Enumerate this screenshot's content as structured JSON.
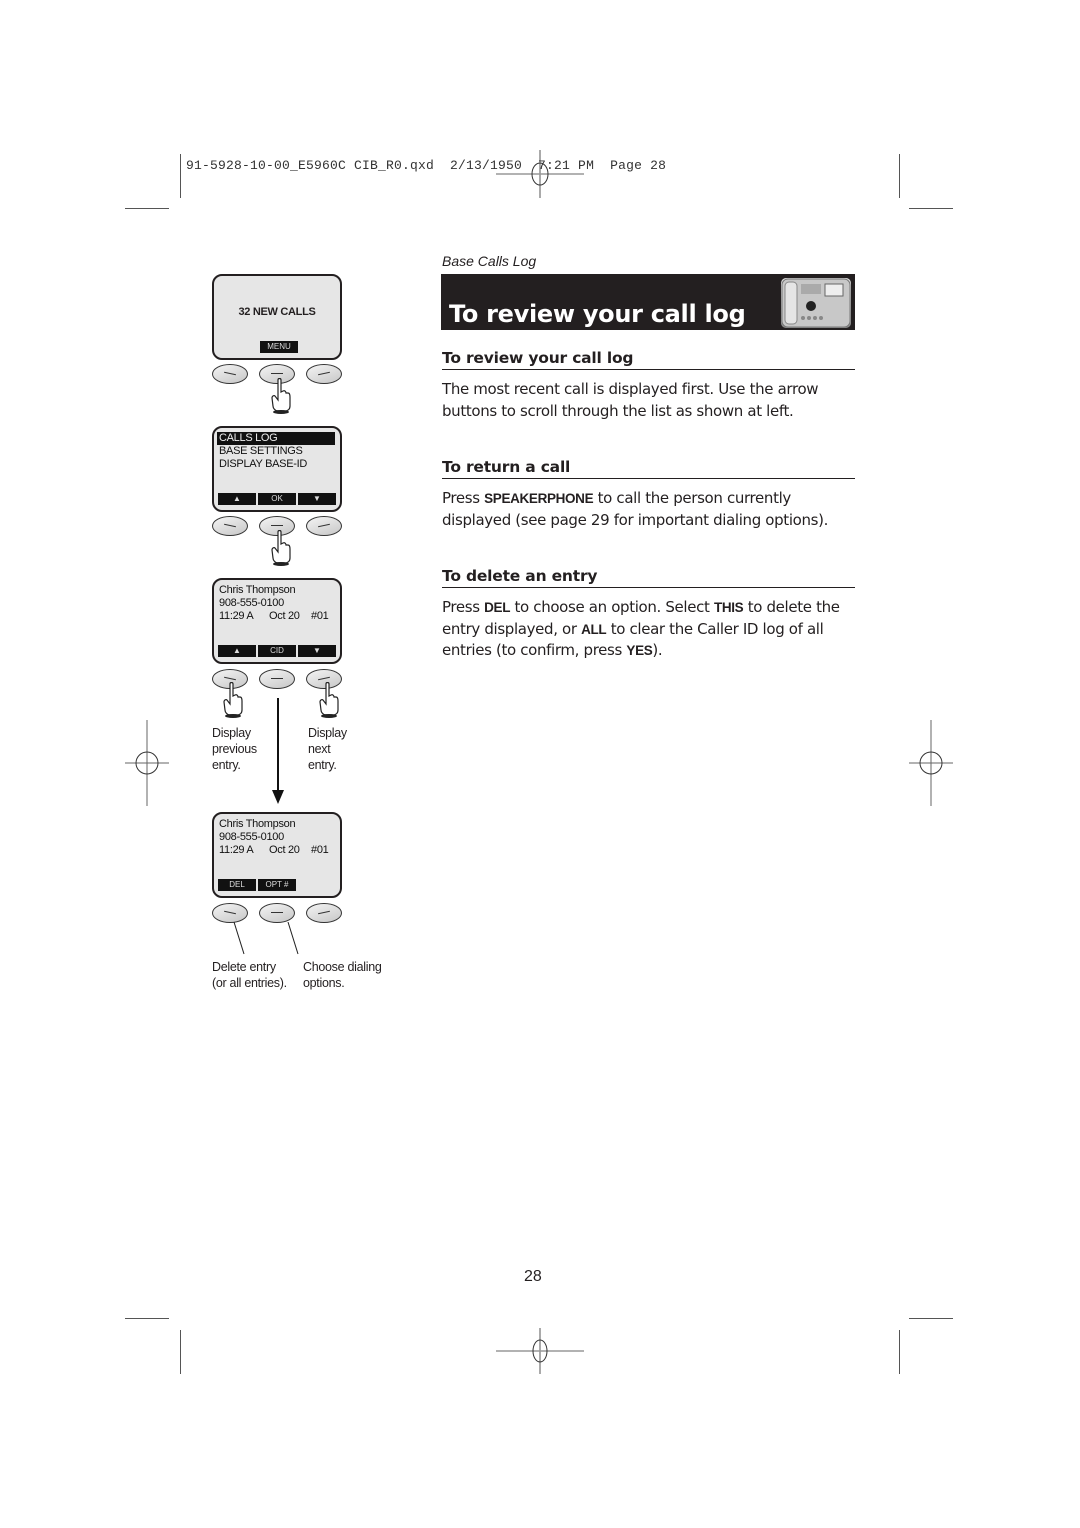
{
  "slug": {
    "text": "91-5928-10-00_E5960C CIB_R0.qxd  2/13/1950  7:21 PM  Page 28"
  },
  "illustration": {
    "screen1": {
      "message": "32 NEW CALLS",
      "softkeys": [
        "MENU"
      ]
    },
    "screen2": {
      "menu_items": [
        "CALLS LOG",
        "BASE SETTINGS",
        "DISPLAY BASE-ID"
      ],
      "selected_index": 0,
      "softkeys": [
        "up-arrow-icon",
        "OK",
        "down-arrow-icon"
      ]
    },
    "screen3": {
      "name": "Chris Thompson",
      "number": "908-555-0100",
      "time": "11:29 A",
      "date": "Oct 20",
      "entry": "#01",
      "softkeys": [
        "up-arrow-icon",
        "CID",
        "down-arrow-icon"
      ]
    },
    "captions_scroll": {
      "previous": "Display previous entry.",
      "previous_lines": [
        "Display",
        "previous",
        "entry."
      ],
      "next_lines": [
        "Display",
        "next",
        "entry."
      ]
    },
    "screen4": {
      "name": "Chris Thompson",
      "number": "908-555-0100",
      "time": "11:29 A",
      "date": "Oct 20",
      "entry": "#01",
      "softkeys": [
        "DEL",
        "OPT #"
      ]
    },
    "captions_delete": {
      "delete_lines": [
        "Delete entry",
        "(or all entries)."
      ],
      "options_lines": [
        "Choose dialing",
        "options."
      ]
    }
  },
  "content": {
    "section_tag": "Base Calls Log",
    "title": "To review your call log",
    "sections": [
      {
        "heading": "To review your call log",
        "body": [
          {
            "t": "The most recent call is displayed first. Use the arrow buttons to scroll through the list as shown at left."
          }
        ]
      },
      {
        "heading": "To return a call",
        "body": [
          {
            "t": "Press "
          },
          {
            "k": "SPEAKERPHONE"
          },
          {
            "t": " to call the person currently displayed (see page 29 for important dialing options)."
          }
        ]
      },
      {
        "heading": "To delete an entry",
        "body": [
          {
            "t": "Press "
          },
          {
            "k": "DEL"
          },
          {
            "t": " to choose an option. Select "
          },
          {
            "k": "THIS"
          },
          {
            "t": " to delete the entry displayed, or "
          },
          {
            "k": "ALL"
          },
          {
            "t": " to clear the Caller ID log of all entries (to confirm, press "
          },
          {
            "k": "YES"
          },
          {
            "t": ")."
          }
        ]
      }
    ]
  },
  "page_number": "28",
  "colors": {
    "title_bar": "#231f20",
    "title_text": "#ffffff",
    "lcd_background": "#e6e6e6"
  }
}
